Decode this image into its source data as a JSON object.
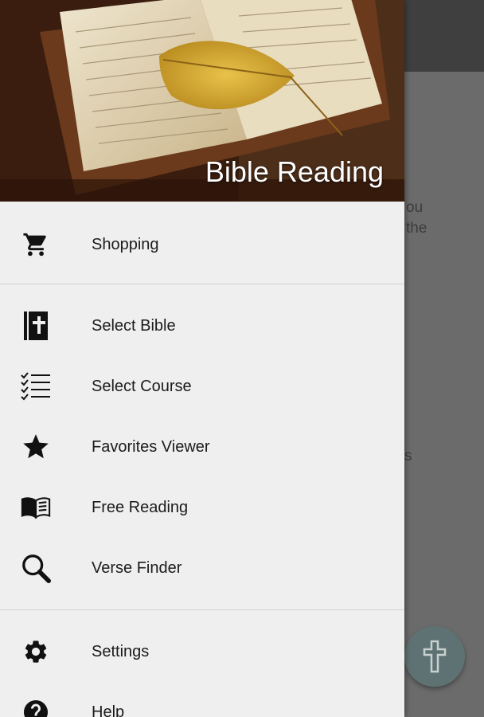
{
  "background": {
    "text_fragments": [
      "ou",
      "the",
      "s"
    ]
  },
  "drawer": {
    "header_title": "Bible Reading",
    "items": [
      {
        "label": "Shopping",
        "icon": "cart-icon"
      },
      {
        "label": "Select Bible",
        "icon": "bible-icon"
      },
      {
        "label": "Select Course",
        "icon": "checklist-icon"
      },
      {
        "label": "Favorites Viewer",
        "icon": "star-icon"
      },
      {
        "label": "Free Reading",
        "icon": "open-book-icon"
      },
      {
        "label": "Verse Finder",
        "icon": "search-icon"
      },
      {
        "label": "Settings",
        "icon": "gear-icon"
      },
      {
        "label": "Help",
        "icon": "help-icon"
      }
    ]
  },
  "fab": {
    "icon": "cross-icon"
  },
  "colors": {
    "drawer_bg": "#efefef",
    "scrim": "#6b6b6b",
    "fab": "#5f7273",
    "header_text": "#ffffff"
  }
}
